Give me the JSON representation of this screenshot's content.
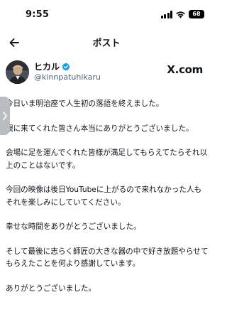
{
  "status_bar": {
    "time": "9:55",
    "battery": "68"
  },
  "header": {
    "title": "ポスト"
  },
  "author": {
    "name": "ヒカル",
    "handle": "@kinnpatuhikaru",
    "source_logo": "X.com"
  },
  "post": {
    "paragraphs": [
      "今日いま明治座で人生初の落語を終えました。",
      "観に来てくれた皆さん本当にありがとうございました。",
      "会場に足を運んでくれた皆様が満足してもらえてたらそれ以上のことはないです。",
      "今回の映像は後日YouTubeに上がるので来れなかった人もそれを楽しみにしていてください。",
      "幸せな時間をありがとうございました。",
      "そして最後に志らく師匠の大きな器の中で好き放題やらせてもらえたことを何より感謝しています。",
      "ありがとうございました。"
    ]
  },
  "colors": {
    "text": "#0f1419",
    "handle": "#536471",
    "verified": "#1d9bf0",
    "edge_tab": "#b9bcc0"
  },
  "icons": {
    "back": "arrow-left-icon",
    "verified": "verified-badge-icon",
    "edge_tab": "chevron-right-icon",
    "signal": "signal-icon",
    "wifi": "wifi-icon",
    "battery": "battery-icon"
  }
}
